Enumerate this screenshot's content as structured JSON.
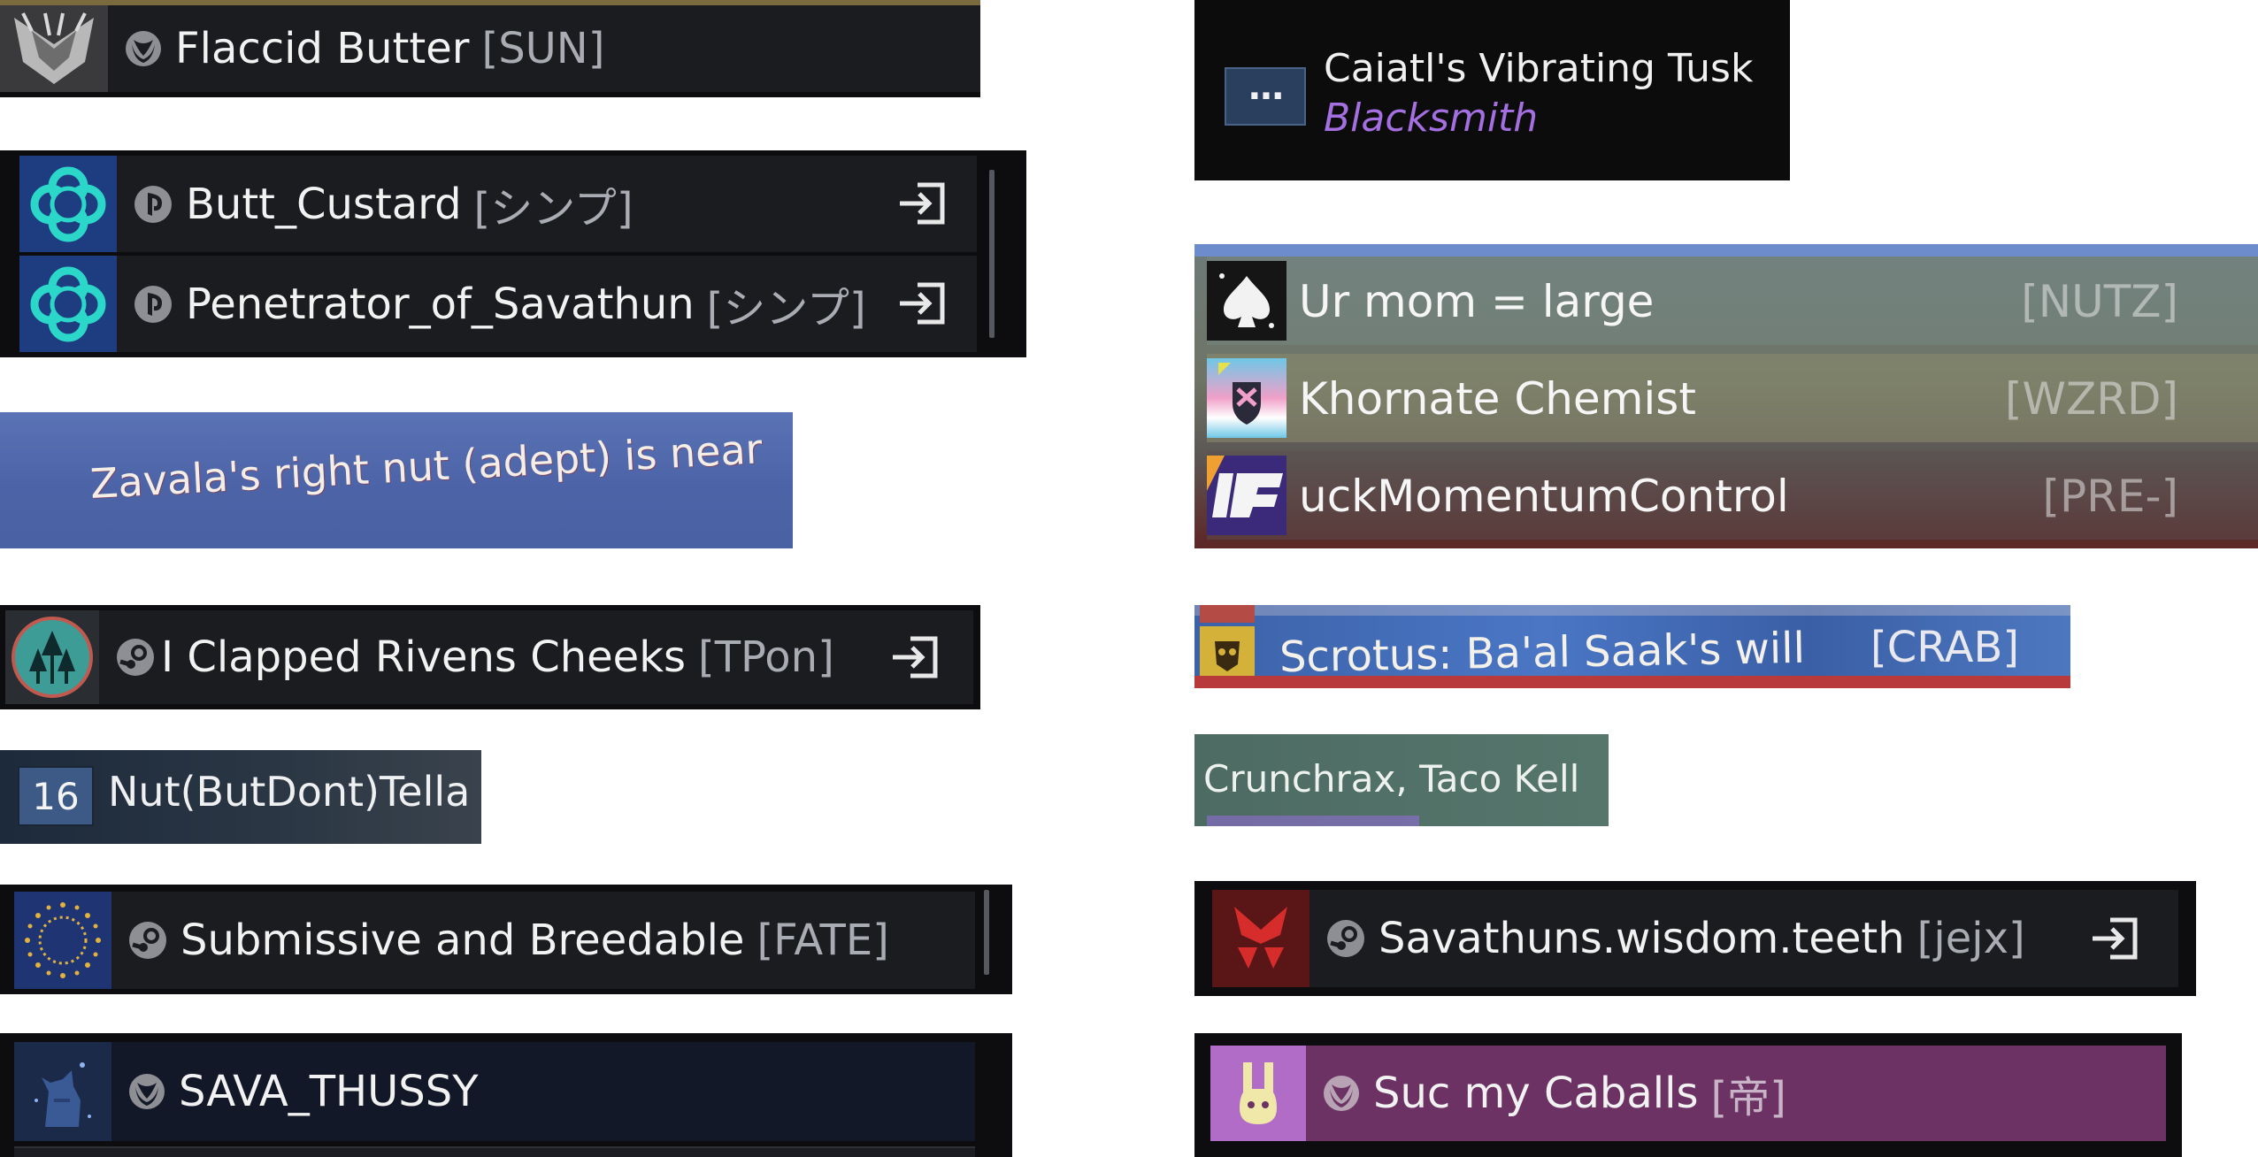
{
  "left_column": {
    "row_sun": {
      "name": "Flaccid Butter",
      "clan": "[SUN]",
      "platform_icon": "xbox-icon"
    },
    "group_symp": {
      "rows": [
        {
          "name": "Butt_Custard",
          "clan": "[シンプ]",
          "platform_icon": "playstation-icon"
        },
        {
          "name": "Penetrator_of_Savathun",
          "clan": "[シンプ]",
          "platform_icon": "playstation-icon"
        }
      ]
    },
    "banner": {
      "text": "Zavala's right nut (adept) is near"
    },
    "row_tpon": {
      "name": "I Clapped Rivens Cheeks",
      "clan": "[TPon]",
      "platform_icon": "steam-icon"
    },
    "row_level": {
      "level": "16",
      "name": "Nut(ButDont)Tella"
    },
    "row_fate": {
      "name": "Submissive and Breedable",
      "clan": "[FATE]",
      "platform_icon": "steam-icon"
    },
    "row_sava": {
      "name": "SAVA_THUSSY",
      "platform_icon": "xbox-icon"
    }
  },
  "right_column": {
    "weapon_card": {
      "more_label": "···",
      "weapon_name": "Caiatl's Vibrating Tusk",
      "subtitle": "Blacksmith"
    },
    "fireteam": {
      "rows": [
        {
          "name": "Ur mom = large",
          "clan": "[NUTZ]"
        },
        {
          "name": "Khornate Chemist",
          "clan": "[WZRD]"
        },
        {
          "name": "uckMomentumControl",
          "clan": "[PRE-]"
        }
      ]
    },
    "crab_strip": {
      "text": "Scrotus: Ba'al Saak's will",
      "clan": "[CRAB]"
    },
    "taco": {
      "text": "Crunchrax, Taco Kell"
    },
    "row_jejx": {
      "name": "Savathuns.wisdom.teeth",
      "clan": "[jejx]",
      "platform_icon": "steam-icon"
    },
    "row_teikoku": {
      "name": "Suc my Caballs",
      "clan": "[帝]",
      "platform_icon": "xbox-icon"
    }
  },
  "colors": {
    "row_bg": "#1b1c20",
    "banner_blue": "#4f69ad",
    "subtitle_purple": "#a46fe0",
    "clan_gray": "#a9acb3",
    "magenta_row": "#6b3263"
  }
}
